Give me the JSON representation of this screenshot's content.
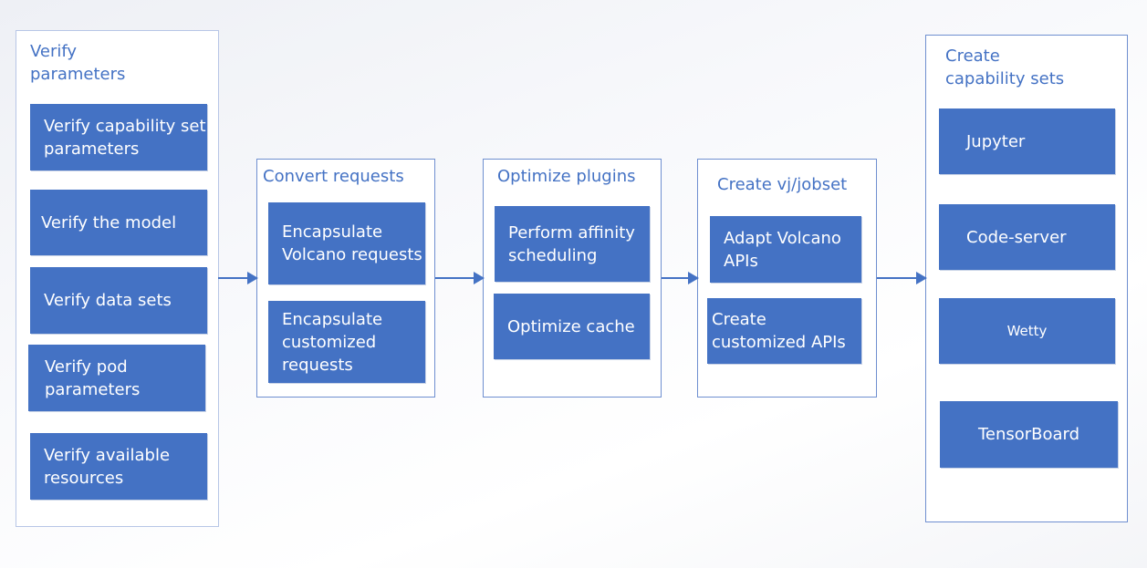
{
  "stages": [
    {
      "title": "Verify parameters",
      "items": [
        "Verify capability set parameters",
        "Verify the model",
        "Verify data sets",
        "Verify pod parameters",
        "Verify available resources"
      ]
    },
    {
      "title": "Convert requests",
      "items": [
        "Encapsulate Volcano requests",
        "Encapsulate customized requests"
      ]
    },
    {
      "title": "Optimize plugins",
      "items": [
        "Perform affinity scheduling",
        "Optimize cache"
      ]
    },
    {
      "title": "Create vj/jobset",
      "items": [
        "Adapt Volcano APIs",
        "Create customized APIs"
      ]
    },
    {
      "title": "Create capability sets",
      "items": [
        "Jupyter",
        "Code-server",
        "Wetty",
        "TensorBoard"
      ]
    }
  ],
  "colors": {
    "box": "#4472c4",
    "title": "#4472c4",
    "border": "#6f8fd0"
  }
}
